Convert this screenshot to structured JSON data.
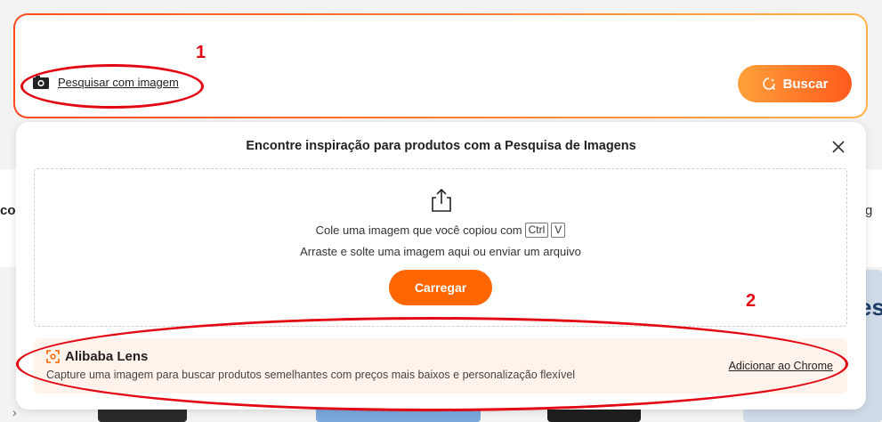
{
  "search": {
    "image_search_label": "Pesquisar com imagem",
    "button_label": "Buscar"
  },
  "panel": {
    "title": "Encontre inspiração para produtos com a Pesquisa de Imagens",
    "paste_text": "Cole uma imagem que você copiou com",
    "key_ctrl": "Ctrl",
    "key_v": "V",
    "drag_text": "Arraste e solte uma imagem aqui ou enviar um arquivo",
    "upload_button": "Carregar"
  },
  "lens": {
    "title": "Alibaba Lens",
    "description": "Capture uma imagem para buscar produtos semelhantes com preços mais baixos e personalização flexível",
    "chrome_link": "Adicionar ao Chrome"
  },
  "annotations": {
    "label_1": "1",
    "label_2": "2",
    "color": "#e30613"
  },
  "background": {
    "left_word": "co",
    "right_word": "g",
    "card_text": "es"
  },
  "colors": {
    "accent": "#ff6600",
    "lens_bg": "#fff3ec"
  }
}
